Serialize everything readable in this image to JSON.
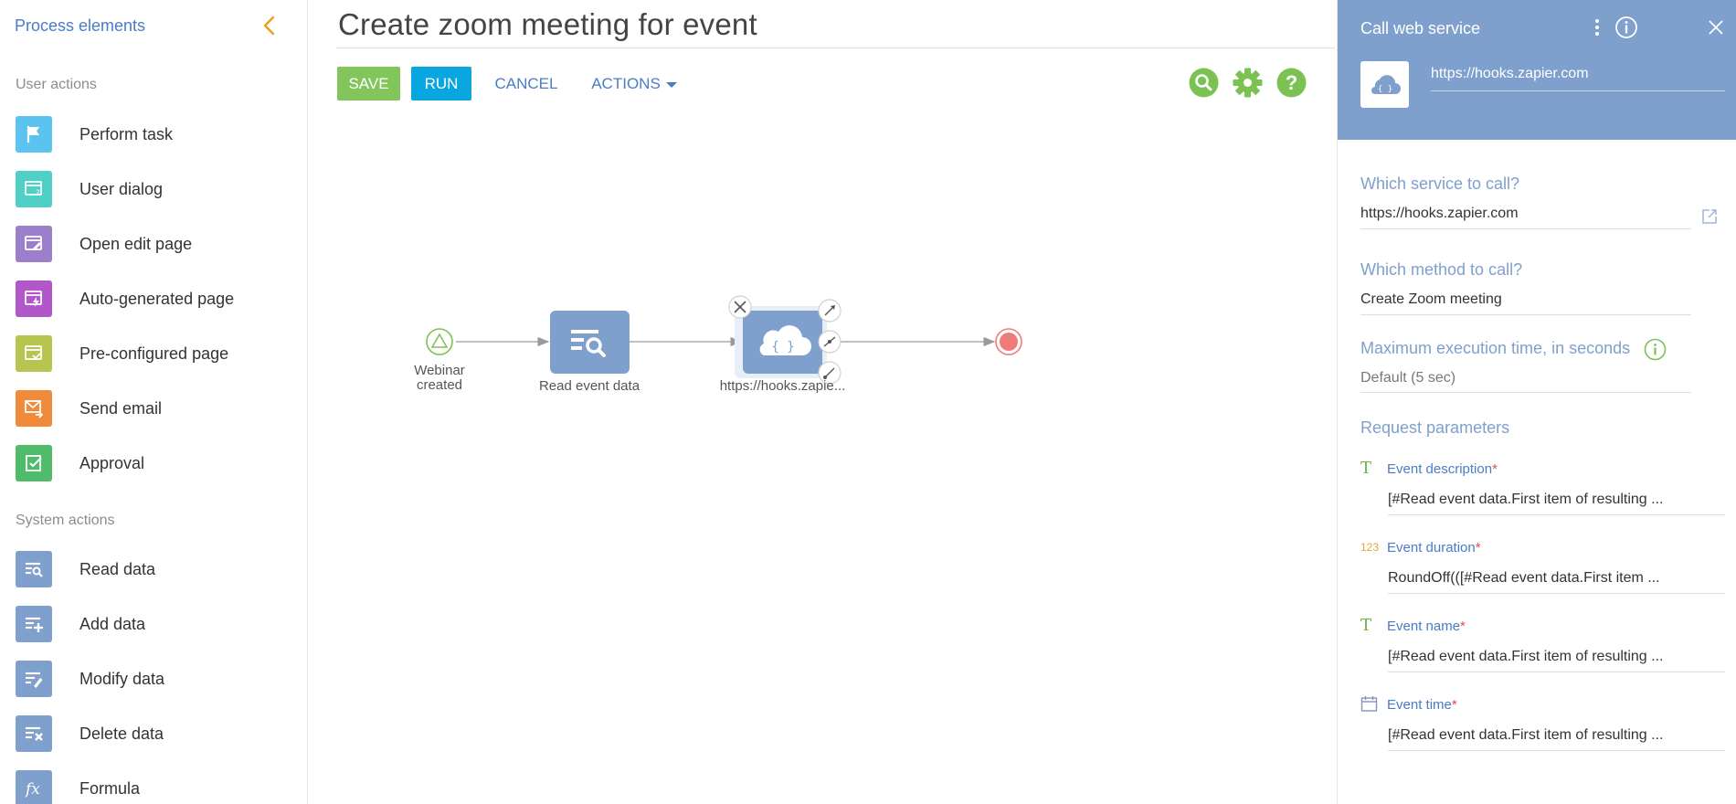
{
  "sidebar": {
    "title": "Process elements",
    "sections": {
      "user_actions": "User actions",
      "system_actions": "System actions"
    },
    "user_items": [
      {
        "label": "Perform task",
        "icon": "flag-icon",
        "color": "#5bc3f0"
      },
      {
        "label": "User dialog",
        "icon": "dialog-icon",
        "color": "#4fcfc5"
      },
      {
        "label": "Open edit page",
        "icon": "edit-page-icon",
        "color": "#9b7fcb"
      },
      {
        "label": "Auto-generated page",
        "icon": "auto-page-icon",
        "color": "#b257c9"
      },
      {
        "label": "Pre-configured page",
        "icon": "preconfigured-page-icon",
        "color": "#b7c44f"
      },
      {
        "label": "Send email",
        "icon": "email-icon",
        "color": "#f28a3c"
      },
      {
        "label": "Approval",
        "icon": "approval-icon",
        "color": "#4ebc6b"
      }
    ],
    "system_items": [
      {
        "label": "Read data",
        "icon": "read-data-icon",
        "color": "#7f9fcd"
      },
      {
        "label": "Add data",
        "icon": "add-data-icon",
        "color": "#7f9fcd"
      },
      {
        "label": "Modify data",
        "icon": "modify-data-icon",
        "color": "#7f9fcd"
      },
      {
        "label": "Delete data",
        "icon": "delete-data-icon",
        "color": "#7f9fcd"
      },
      {
        "label": "Formula",
        "icon": "formula-icon",
        "color": "#7f9fcd"
      }
    ]
  },
  "header": {
    "title": "Create zoom meeting for event",
    "save_label": "SAVE",
    "run_label": "RUN",
    "cancel_label": "CANCEL",
    "actions_label": "ACTIONS"
  },
  "colors": {
    "save": "#82c55a",
    "run": "#0aa6df",
    "link": "#4a7cc6",
    "panel_header": "#7f9fcd",
    "tool_icons": "#7cc253"
  },
  "flow": {
    "start_label": [
      "Webinar",
      "created"
    ],
    "read_label": "Read event data",
    "webservice_label": "https://hooks.zapie..."
  },
  "panel": {
    "title": "Call web service",
    "header_url": "https://hooks.zapier.com",
    "service_label": "Which service to call?",
    "service_value": "https://hooks.zapier.com",
    "method_label": "Which method to call?",
    "method_value": "Create Zoom meeting",
    "timeout_label": "Maximum execution time, in seconds",
    "timeout_value": "Default (5 sec)",
    "params_title": "Request parameters",
    "params": [
      {
        "type_glyph": "T",
        "label": "Event description",
        "value": "[#Read event data.First item of resulting ..."
      },
      {
        "type_glyph": "123",
        "label": "Event duration",
        "value": "RoundOff(([#Read event data.First item ..."
      },
      {
        "type_glyph": "T",
        "label": "Event name",
        "value": "[#Read event data.First item of resulting ..."
      },
      {
        "type_glyph": "calendar",
        "label": "Event time",
        "value": "[#Read event data.First item of resulting ..."
      }
    ],
    "required_mark": "*"
  }
}
